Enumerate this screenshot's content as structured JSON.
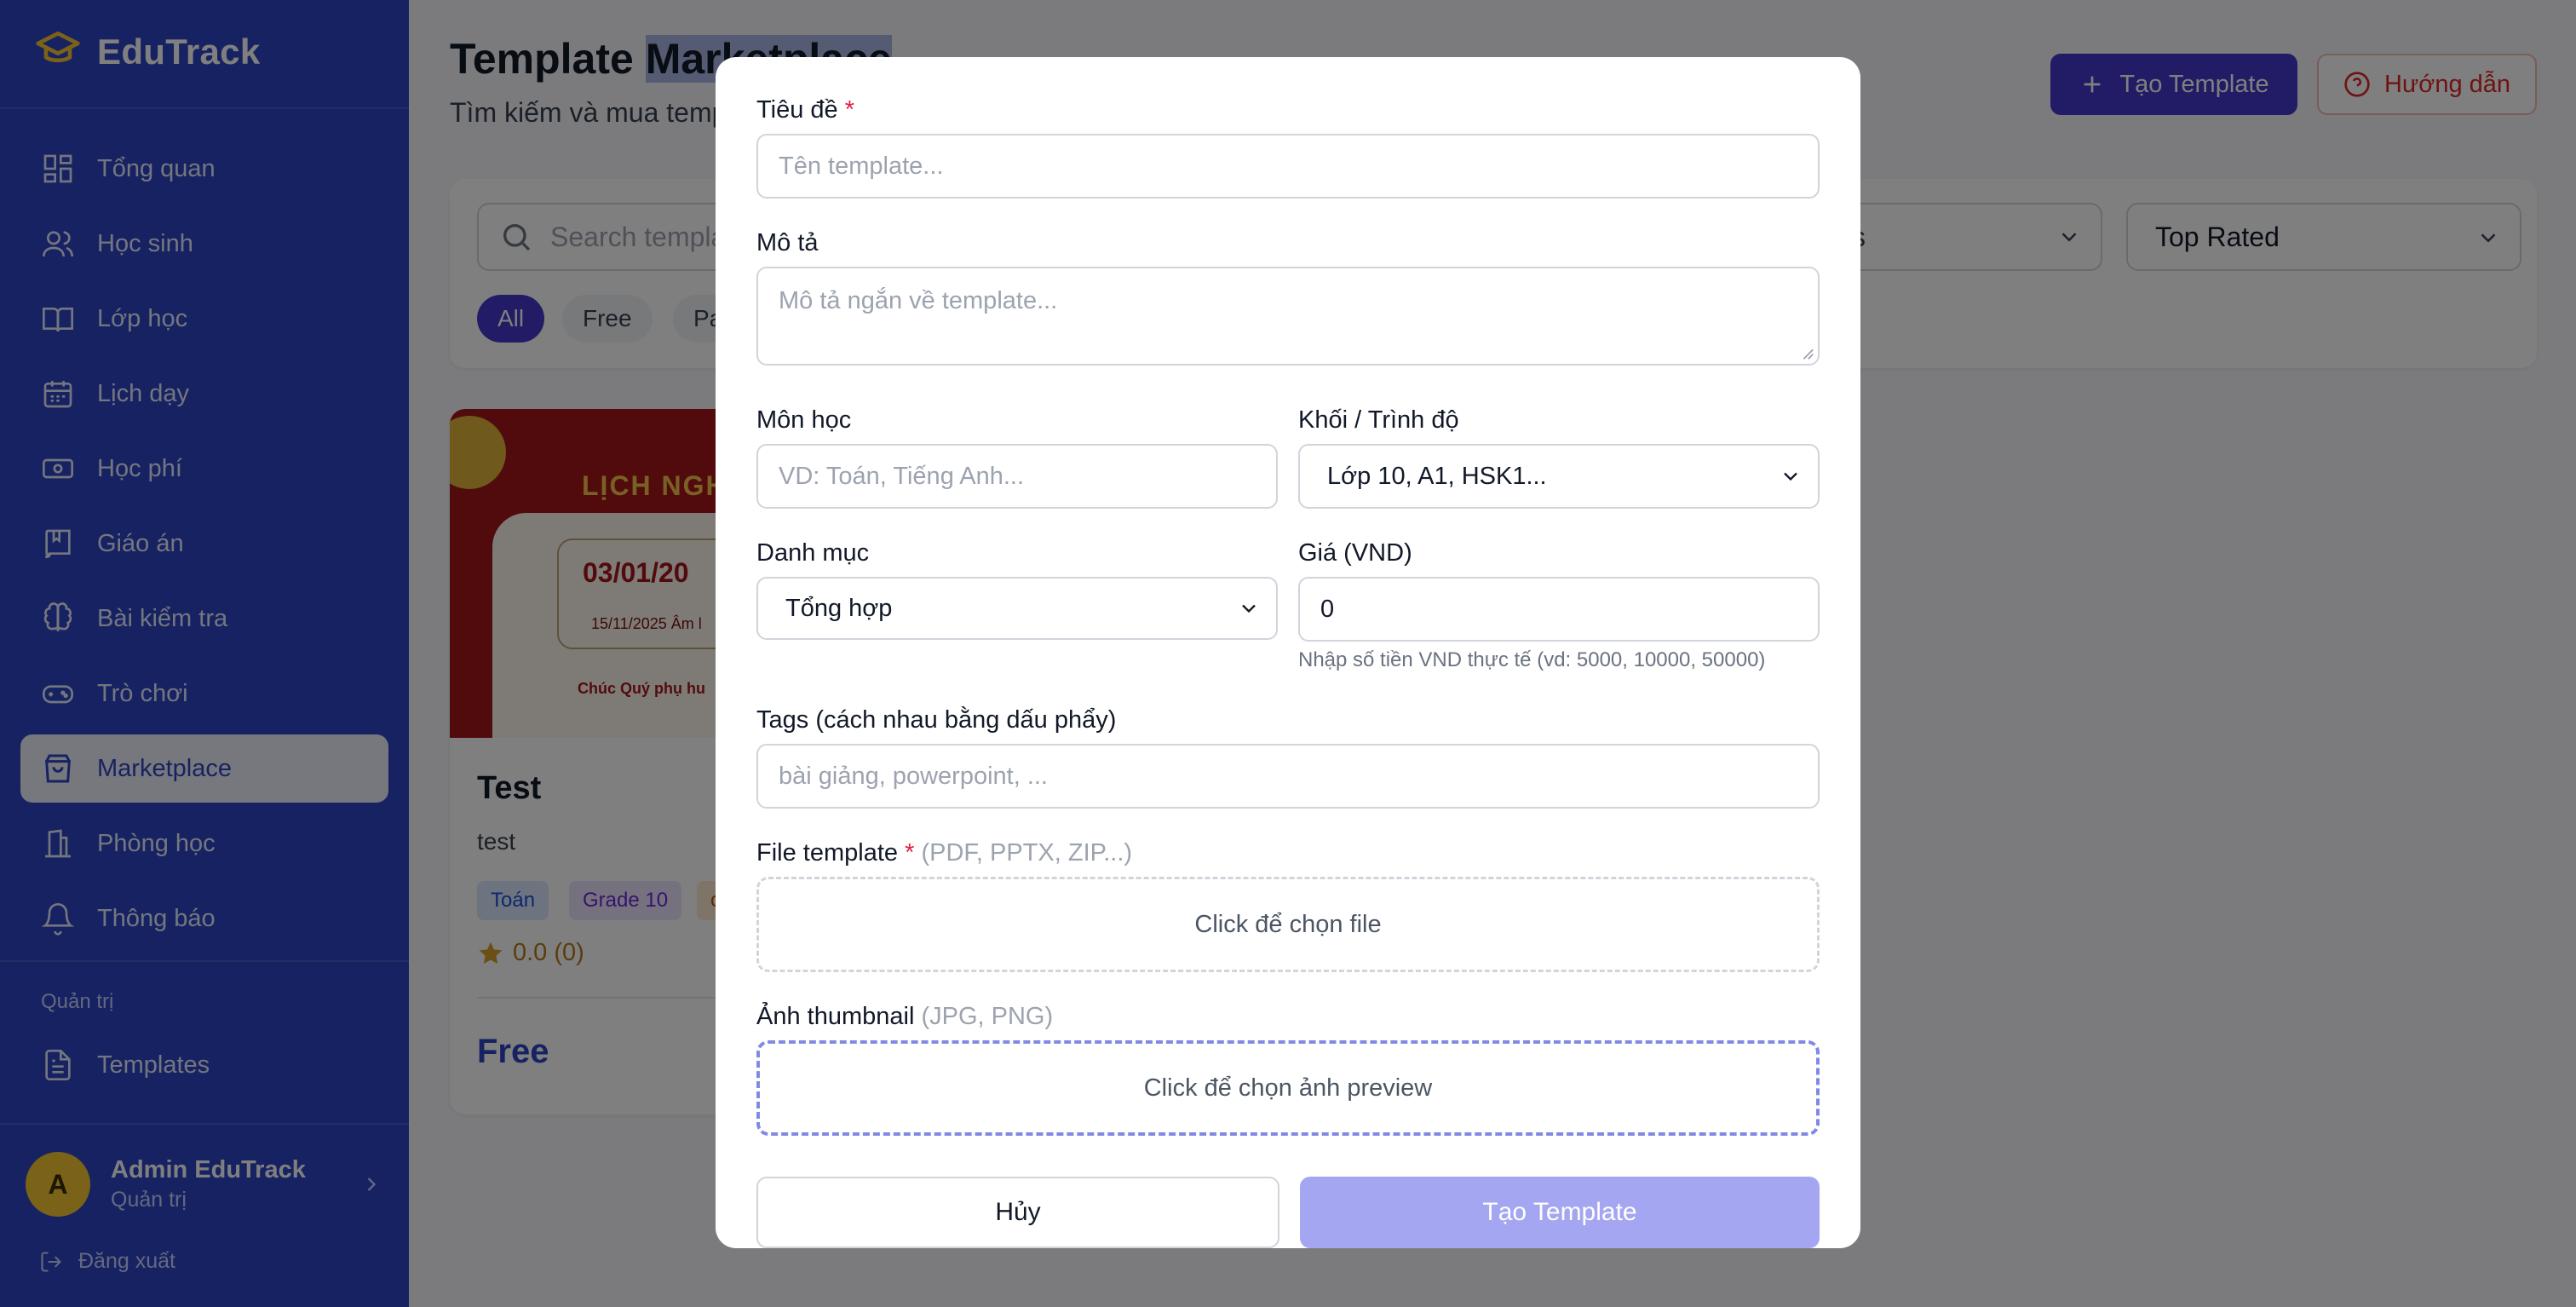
{
  "app": {
    "brand": "EduTrack"
  },
  "sidebar": {
    "items": [
      {
        "label": "Tổng quan",
        "icon": "dashboard-icon"
      },
      {
        "label": "Học sinh",
        "icon": "users-icon"
      },
      {
        "label": "Lớp học",
        "icon": "book-open-icon"
      },
      {
        "label": "Lịch dạy",
        "icon": "calendar-icon"
      },
      {
        "label": "Học phí",
        "icon": "banknote-icon"
      },
      {
        "label": "Giáo án",
        "icon": "notebook-icon"
      },
      {
        "label": "Bài kiểm tra",
        "icon": "brain-icon"
      },
      {
        "label": "Trò chơi",
        "icon": "gamepad-icon"
      },
      {
        "label": "Marketplace",
        "icon": "shopping-bag-icon",
        "active": true
      },
      {
        "label": "Phòng học",
        "icon": "building-icon"
      },
      {
        "label": "Thông báo",
        "icon": "bell-icon"
      }
    ],
    "admin_section_label": "Quản trị",
    "admin_items": [
      {
        "label": "Templates",
        "icon": "file-text-icon"
      }
    ],
    "user": {
      "initial": "A",
      "name": "Admin EduTrack",
      "role": "Quản trị"
    },
    "logout_label": "Đăng xuất"
  },
  "header": {
    "title_part1": "Template ",
    "title_part2": "Marketplace",
    "subtitle": "Tìm kiếm và mua temp",
    "create_button": "Tạo Template",
    "guide_button": "Hướng dẫn"
  },
  "filters": {
    "search_placeholder": "Search templa",
    "select_category_fragment": "s",
    "sort_value": "Top Rated",
    "chips": [
      "All",
      "Free",
      "Pai"
    ]
  },
  "card": {
    "title": "Test",
    "description": "test",
    "tags": [
      "Toán",
      "Grade 10",
      "c"
    ],
    "rating": "0.0 (0)",
    "price": "Free",
    "thumbnail": {
      "heading": "LỊCH NGH",
      "date": "03/01/20",
      "small_text": "15/11/2025 Âm l",
      "wish": "Chúc Quý phụ hu"
    }
  },
  "modal": {
    "title_label": "Tiêu đề",
    "title_placeholder": "Tên template...",
    "desc_label": "Mô tả",
    "desc_placeholder": "Mô tả ngắn về template...",
    "subject_label": "Môn học",
    "subject_placeholder": "VD: Toán, Tiếng Anh...",
    "level_label": "Khối / Trình độ",
    "level_value": "Lớp 10, A1, HSK1...",
    "category_label": "Danh mục",
    "category_value": "Tổng hợp",
    "price_label": "Giá (VND)",
    "price_value": "0",
    "price_note": "Nhập số tiền VND thực tế (vd: 5000, 10000, 50000)",
    "tags_label": "Tags (cách nhau bằng dấu phẩy)",
    "tags_placeholder": "bài giảng, powerpoint, ...",
    "file_label": "File template",
    "file_hint": "(PDF, PPTX, ZIP...)",
    "file_drop": "Click để chọn file",
    "thumb_label": "Ảnh thumbnail",
    "thumb_hint": "(JPG, PNG)",
    "thumb_drop": "Click để chọn ảnh preview",
    "cancel_button": "Hủy",
    "submit_button": "Tạo Template"
  }
}
